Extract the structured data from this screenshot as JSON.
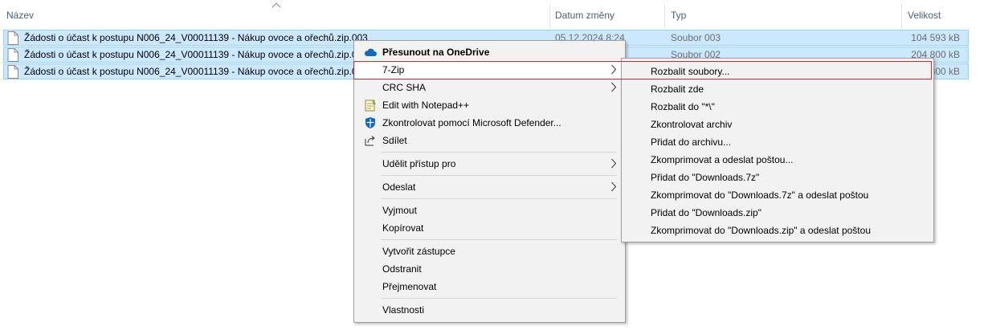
{
  "columns": {
    "name": "Název",
    "date": "Datum změny",
    "type": "Typ",
    "size": "Velikost"
  },
  "files": [
    {
      "name": "Žádosti o účast k postupu N006_24_V00011139 - Nákup ovoce a ořechů.zip.003",
      "date": "05.12.2024 8:24",
      "type": "Soubor 003",
      "size": "104 593 kB"
    },
    {
      "name": "Žádosti o účast k postupu N006_24_V00011139 - Nákup ovoce a ořechů.zip.002",
      "date": "",
      "type": "Soubor 002",
      "size": "204 800 kB"
    },
    {
      "name": "Žádosti o účast k postupu N006_24_V00011139 - Nákup ovoce a ořechů.zip.001",
      "date": "",
      "type": "",
      "size": "800 kB"
    }
  ],
  "context_menu": {
    "onedrive": "Přesunout na OneDrive",
    "sevenzip": "7-Zip",
    "crc": "CRC SHA",
    "notepad": "Edit with Notepad++",
    "defender": "Zkontrolovat pomocí Microsoft Defender...",
    "share": "Sdílet",
    "grant_access": "Udělit přístup pro",
    "send_to": "Odeslat",
    "cut": "Vyjmout",
    "copy": "Kopírovat",
    "create_shortcut": "Vytvořit zástupce",
    "delete": "Odstranit",
    "rename": "Přejmenovat",
    "properties": "Vlastnosti"
  },
  "zip_menu": {
    "items": [
      "Rozbalit soubory...",
      "Rozbalit zde",
      "Rozbalit do \"*\\\"",
      "Zkontrolovat archiv",
      "Přidat do archivu...",
      "Zkomprimovat a odeslat poštou...",
      "Přidat do \"Downloads.7z\"",
      "Zkomprimovat do \"Downloads.7z\" a odeslat poštou",
      "Přidat do \"Downloads.zip\"",
      "Zkomprimovat do \"Downloads.zip\" a odeslat poštou"
    ]
  },
  "colors": {
    "selection": "#cce8ff",
    "selection_border": "#99d1ff",
    "menu_bg": "#f2f2f2",
    "highlight_border": "#d9232d",
    "onedrive": "#0f6cbd",
    "defender": "#1565c0"
  },
  "icons": {
    "file": "file-icon",
    "onedrive": "onedrive-cloud-icon",
    "notepad": "notepad-plus-plus-icon",
    "defender": "defender-shield-icon",
    "share": "share-icon",
    "submenu": "chevron-right-icon",
    "sort": "sort-up-icon"
  }
}
